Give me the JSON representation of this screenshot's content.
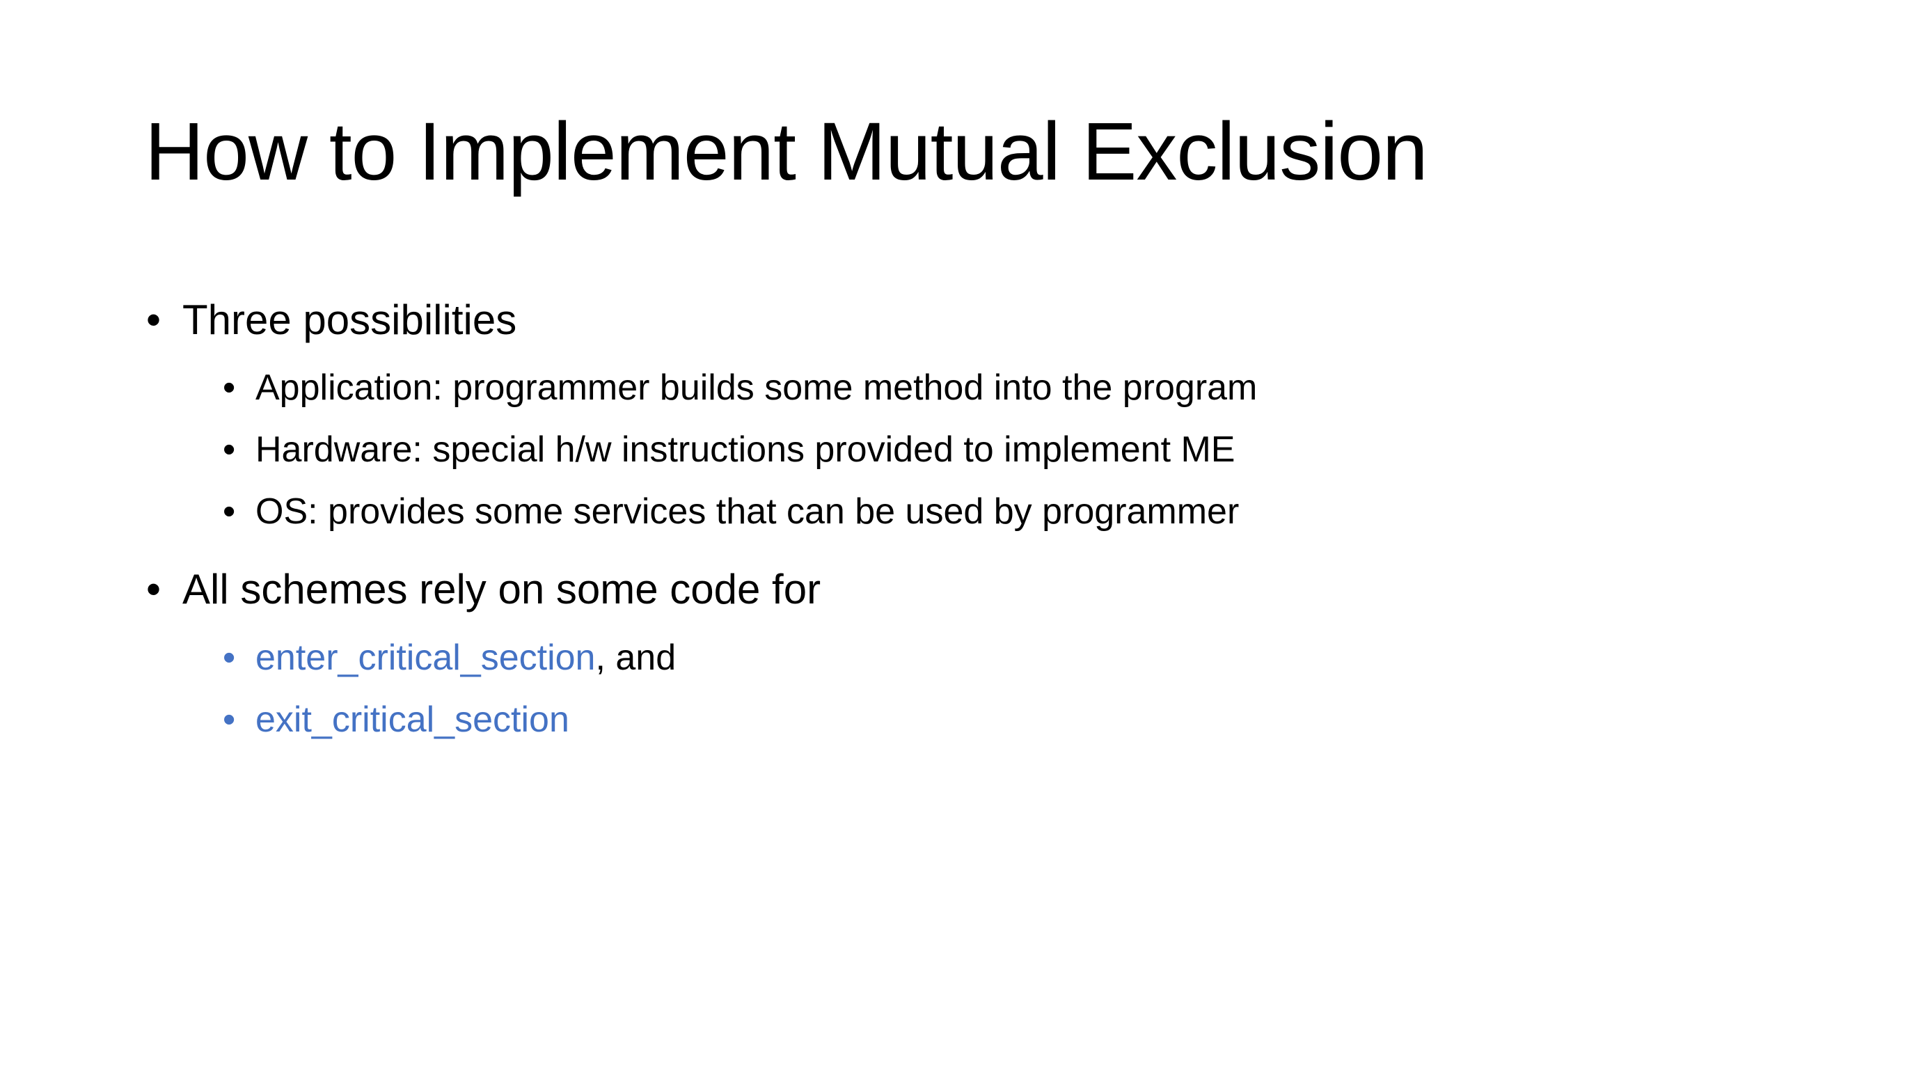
{
  "slide": {
    "title": "How to Implement Mutual Exclusion",
    "bullet_glyph": "•",
    "items": [
      {
        "text": "Three possibilities"
      },
      {
        "text": "Application: programmer builds some method into the program"
      },
      {
        "text": "Hardware: special h/w instructions provided to implement ME"
      },
      {
        "text": "OS: provides some services that can be used by programmer"
      },
      {
        "text": "All schemes rely on some code for"
      },
      {
        "text": "enter_critical_section",
        "suffix": ", and"
      },
      {
        "text": "exit_critical_section"
      }
    ],
    "colors": {
      "accent": "#4472C4",
      "text": "#000000"
    }
  }
}
